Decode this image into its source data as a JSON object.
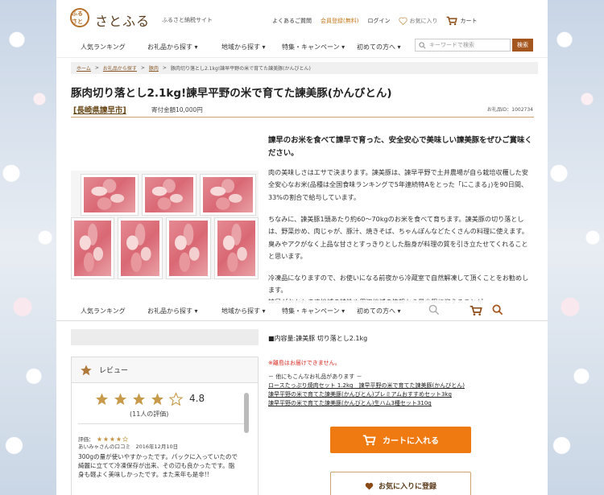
{
  "header": {
    "logo_text": "ふるさと",
    "brand": "さとふる",
    "brand_sub": "ふるさと納税サイト",
    "faq": "よくあるご質問",
    "register": "会員登録(無料)",
    "login": "ログイン",
    "favorites": "お気に入り",
    "cart": "カート"
  },
  "nav": {
    "items": [
      "人気ランキング",
      "お礼品から探す",
      "地域から探す",
      "特集・キャンペーン",
      "初めての方へ"
    ],
    "search_placeholder": "キーワードで検索",
    "search_button": "検索"
  },
  "breadcrumb": {
    "home": "ホーム",
    "sep": ">",
    "category": "お礼品から探す",
    "subcategory": "豚肉",
    "current": "豚肉切り落とし2.1kg!諫早平野の米で育てた諫美豚(かんびとん)"
  },
  "product": {
    "title": "豚肉切り落とし2.1kg!諫早平野の米で育てた諫美豚(かんびとん)",
    "city": "[長崎県諫早市]",
    "amount": "寄付金額10,000円",
    "id": "お礼品ID：1002734",
    "lead": "諫早のお米を食べて諫早で育った、安全安心で美味しい諫美豚をぜひご賞味ください。",
    "desc1": "肉の美味しさはエサで決まります。諫美豚は、諫早平野で土井農場が自ら栽培収穫した安全安心なお米(品種は全国食味ランキングで5年連続特Aをとった「にこまる」)を90日間、33%の割合で給与しています。",
    "desc2": "ちなみに、諫美豚1頭あたり約60～70kgのお米を食べて育ちます。諫美豚の切り落としは、野菜炒め、肉じゃが、豚汁、焼きそば、ちゃんぽんなどたくさんの料理に使えます。臭みやアクがなく上品な甘さとすっきりとした脂身が料理の質を引き立たせてくれることと思います。",
    "desc3": "冷凍品になりますので、お使いになる前夜から冷蔵室で自然解凍して頂くことをお勧めします。",
    "desc4": "諫早がおかれます地域の特性や周辺地域の情報から最少限に抑えることが"
  },
  "spec": "■内容量:諫美豚 切り落とし2.1kg",
  "warning": "※離島はお届けできません。",
  "others_title": "－ 他にもこんなお礼品があります －",
  "others": [
    "ロースたっぷり焼肉セット 1.2kg　諫早平野の米で育てた諫美豚(かんびとん)",
    "諫早平野の米で育てた諫美豚(かんびとん)プレミアムおすすめセット3kg",
    "諫早平野の米で育てた諫美豚(かんびとん)生ハム3種セット310g"
  ],
  "review": {
    "heading": "レビュー",
    "rating": "4.8",
    "count": "(11人の評価)",
    "eval_label": "評価：",
    "author": "あいみゃさんの口コミ　2016年12月10日",
    "body": "300gの量が使いやすかったです。パックに入っていたので綺麗に立てて冷凍保存が出来、その辺も良かったです。脂身も軽よく美味しかったです。また来年も是非!!"
  },
  "buttons": {
    "cart": "カートに入れる",
    "favorite": "お気に入りに登録"
  },
  "colors": {
    "accent": "#ef7a12",
    "brand": "#b5712b",
    "warning": "#d9281e",
    "search_button": "#a5561e"
  }
}
